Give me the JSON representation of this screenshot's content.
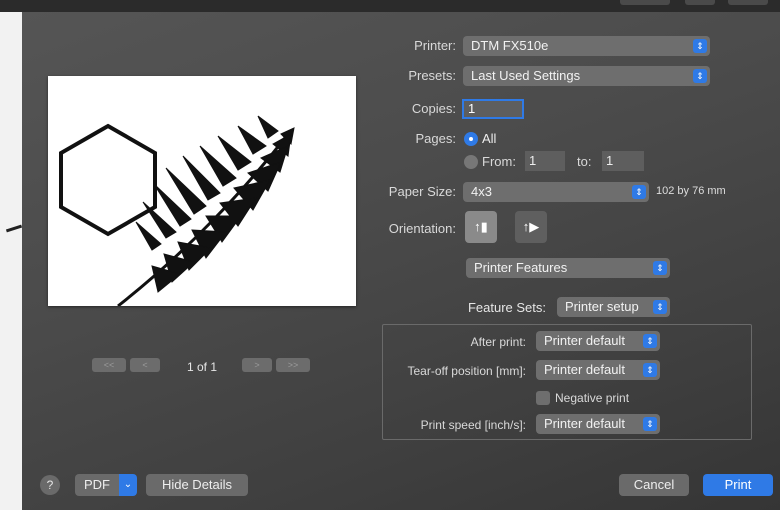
{
  "printer": {
    "label": "Printer:",
    "value": "DTM FX510e"
  },
  "presets": {
    "label": "Presets:",
    "value": "Last Used Settings"
  },
  "copies": {
    "label": "Copies:",
    "value": "1"
  },
  "pages": {
    "label": "Pages:",
    "all_label": "All",
    "from_label": "From:",
    "from_value": "1",
    "to_label": "to:",
    "to_value": "1",
    "selected": "All"
  },
  "paper_size": {
    "label": "Paper Size:",
    "value": "4x3",
    "dimensions": "102 by 76 mm"
  },
  "orientation": {
    "label": "Orientation:",
    "selected": "portrait"
  },
  "section_menu": {
    "value": "Printer Features"
  },
  "feature_sets": {
    "label": "Feature Sets:",
    "value": "Printer setup"
  },
  "features": {
    "after_print": {
      "label": "After print:",
      "value": "Printer default"
    },
    "tear_off": {
      "label": "Tear-off position [mm]:",
      "value": "Printer default"
    },
    "negative_print": {
      "label": "Negative print",
      "checked": false
    },
    "print_speed": {
      "label": "Print speed [inch/s]:",
      "value": "Printer default"
    }
  },
  "pager": {
    "first": "<<",
    "prev": "<",
    "label": "1 of 1",
    "next": ">",
    "last": ">>"
  },
  "footer": {
    "help": "?",
    "pdf": "PDF",
    "hide_details": "Hide Details",
    "cancel": "Cancel",
    "print": "Print"
  },
  "colors": {
    "accent": "#2f7ae6",
    "dialog_bg": "#4b4b4b"
  },
  "icons": [
    "stepper-icon",
    "chevron-down-icon",
    "portrait-icon",
    "landscape-icon",
    "help-icon"
  ]
}
